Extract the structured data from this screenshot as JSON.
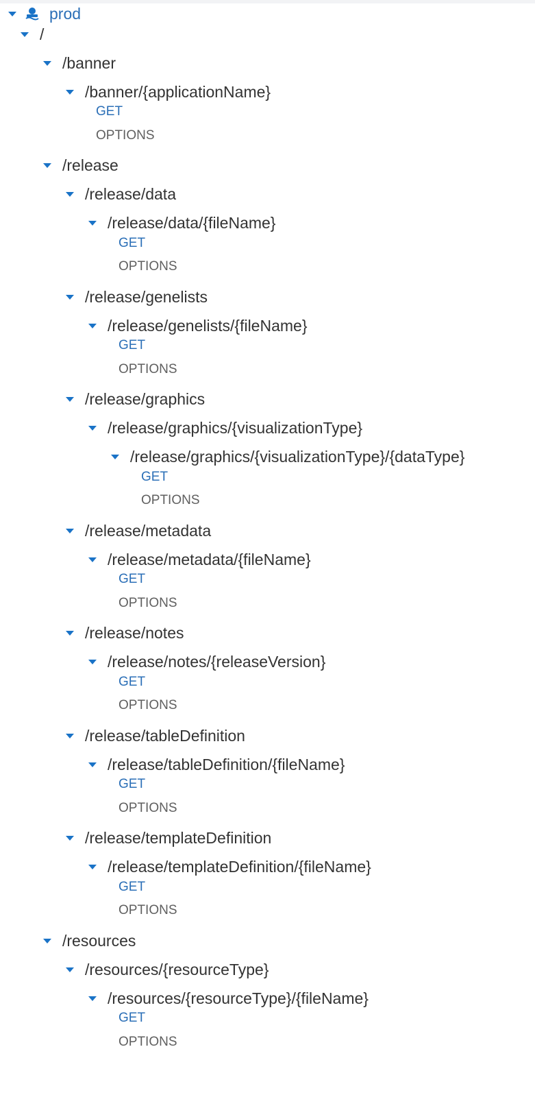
{
  "tree": {
    "stage": {
      "label": "prod",
      "icon": "stage-icon"
    },
    "nodes": [
      {
        "label": "/",
        "depth": 1
      },
      {
        "label": "/banner",
        "depth": 2
      },
      {
        "label": "/banner/{applicationName}",
        "depth": 3,
        "methods": [
          "GET",
          "OPTIONS"
        ]
      },
      {
        "label": "/release",
        "depth": 2
      },
      {
        "label": "/release/data",
        "depth": 3
      },
      {
        "label": "/release/data/{fileName}",
        "depth": 4,
        "methods": [
          "GET",
          "OPTIONS"
        ]
      },
      {
        "label": "/release/genelists",
        "depth": 3
      },
      {
        "label": "/release/genelists/{fileName}",
        "depth": 4,
        "methods": [
          "GET",
          "OPTIONS"
        ]
      },
      {
        "label": "/release/graphics",
        "depth": 3
      },
      {
        "label": "/release/graphics/{visualizationType}",
        "depth": 4
      },
      {
        "label": "/release/graphics/{visualizationType}/{dataType}",
        "depth": 5,
        "methods": [
          "GET",
          "OPTIONS"
        ]
      },
      {
        "label": "/release/metadata",
        "depth": 3
      },
      {
        "label": "/release/metadata/{fileName}",
        "depth": 4,
        "methods": [
          "GET",
          "OPTIONS"
        ]
      },
      {
        "label": "/release/notes",
        "depth": 3
      },
      {
        "label": "/release/notes/{releaseVersion}",
        "depth": 4,
        "methods": [
          "GET",
          "OPTIONS"
        ]
      },
      {
        "label": "/release/tableDefinition",
        "depth": 3
      },
      {
        "label": "/release/tableDefinition/{fileName}",
        "depth": 4,
        "methods": [
          "GET",
          "OPTIONS"
        ]
      },
      {
        "label": "/release/templateDefinition",
        "depth": 3
      },
      {
        "label": "/release/templateDefinition/{fileName}",
        "depth": 4,
        "methods": [
          "GET",
          "OPTIONS"
        ]
      },
      {
        "label": "/resources",
        "depth": 2
      },
      {
        "label": "/resources/{resourceType}",
        "depth": 3
      },
      {
        "label": "/resources/{resourceType}/{fileName}",
        "depth": 4,
        "methods": [
          "GET",
          "OPTIONS"
        ]
      }
    ]
  },
  "colors": {
    "accent": "#1a73c7",
    "get": "#2b6fb7",
    "options": "#5f5f5f",
    "text": "#333333"
  }
}
